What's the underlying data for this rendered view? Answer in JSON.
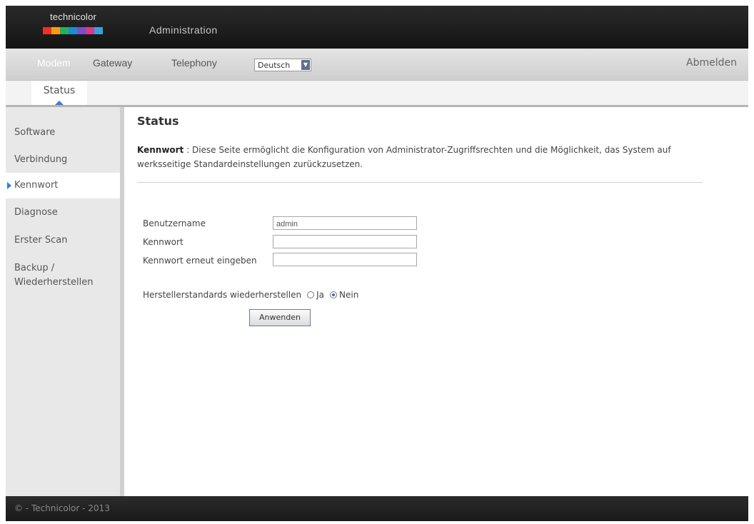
{
  "header": {
    "logo_text": "technicolor",
    "title": "Administration"
  },
  "menu": {
    "items": [
      {
        "label": "Modem",
        "active": true
      },
      {
        "label": "Gateway",
        "active": false
      },
      {
        "label": "Telephony",
        "active": false
      }
    ],
    "language": "Deutsch",
    "logout": "Abmelden"
  },
  "submenu": {
    "tab": "Status"
  },
  "sidebar": {
    "items": [
      {
        "label": "Software"
      },
      {
        "label": "Verbindung"
      },
      {
        "label": "Kennwort",
        "active": true
      },
      {
        "label": "Diagnose"
      },
      {
        "label": "Erster Scan"
      },
      {
        "label": "Backup /\nWiederherstellen"
      }
    ]
  },
  "main": {
    "title": "Status",
    "desc_label": "Kennwort",
    "desc_separator": " : ",
    "desc_text": "Diese Seite ermöglicht die Konfiguration von Administrator-Zugriffsrechten und die Möglichkeit, das System auf werksseitige Standardeinstellungen zurückzusetzen."
  },
  "form": {
    "username_label": "Benutzername",
    "username_value": "admin",
    "password_label": "Kennwort",
    "password_value": "",
    "confirm_label": "Kennwort erneut eingeben",
    "confirm_value": "",
    "restore_label": "Herstellerstandards wiederherstellen",
    "restore_yes": "Ja",
    "restore_no": "Nein",
    "restore_selected": "Nein",
    "apply": "Anwenden"
  },
  "footer": {
    "text": "© - Technicolor - 2013"
  },
  "colors": {
    "header_bg": "#1c1c1c",
    "accent_blue": "#2e7fd6"
  }
}
